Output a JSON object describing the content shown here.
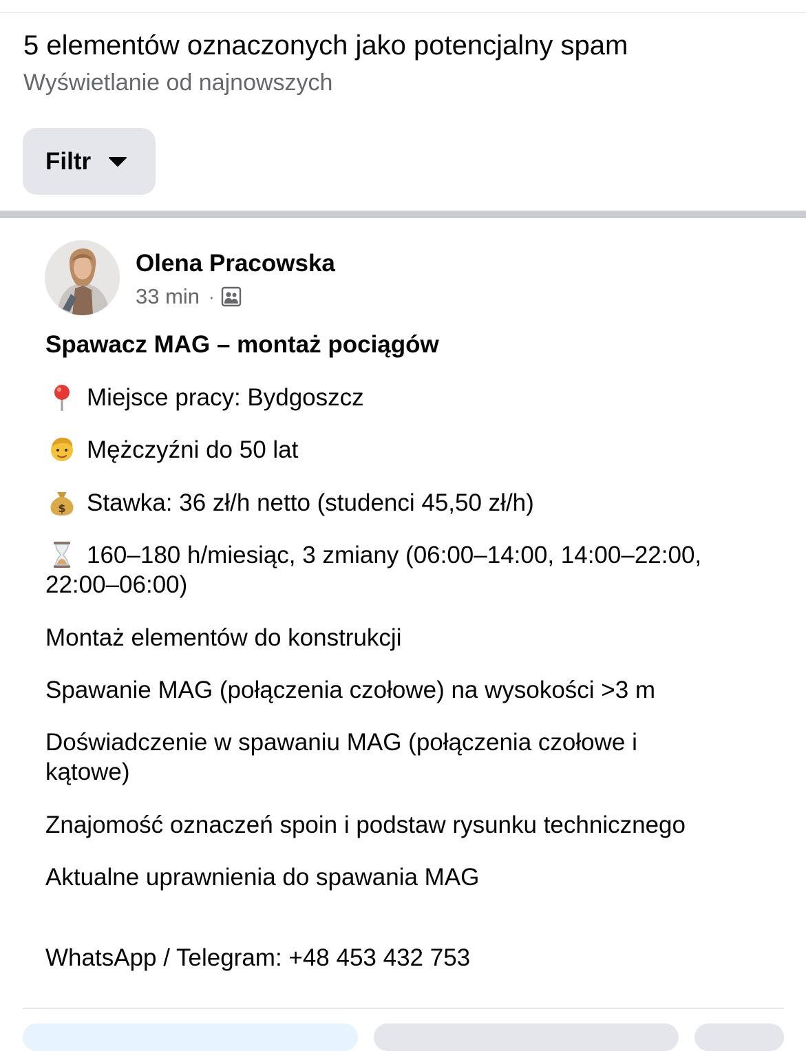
{
  "header": {
    "title": "5 elementów oznaczonych jako potencjalny spam",
    "subtitle": "Wyświetlanie od najnowszych",
    "filter_label": "Filtr"
  },
  "post": {
    "author": "Olena Pracowska",
    "time": "33 min",
    "meta_separator": "·",
    "audience_icon": "group-icon",
    "title": "Spawacz MAG – montaż pociągów",
    "lines": [
      {
        "emoji": "pushpin",
        "text": "Miejsce pracy: Bydgoszcz"
      },
      {
        "emoji": "man",
        "text": "Mężczyźni do 50 lat"
      },
      {
        "emoji": "money-bag",
        "text": "Stawka: 36 zł/h netto (studenci 45,50 zł/h)"
      },
      {
        "emoji": "hourglass",
        "text": "160–180 h/miesiąc, 3 zmiany (06:00–14:00, 14:00–22:00, 22:00–06:00)"
      },
      {
        "text": "Montaż elementów do konstrukcji"
      },
      {
        "text": "Spawanie MAG (połączenia czołowe) na wysokości >3 m"
      },
      {
        "text": "Doświadczenie w spawaniu MAG (połączenia czołowe i kątowe)"
      },
      {
        "text": "Znajomość oznaczeń spoin i podstaw rysunku technicznego"
      },
      {
        "text": "Aktualne uprawnienia do spawania MAG"
      },
      {
        "text": "WhatsApp / Telegram: +48 453 432 753"
      }
    ]
  },
  "colors": {
    "text_primary": "#050505",
    "text_secondary": "#65676b",
    "button_bg": "#e4e6eb",
    "primary_button_bg": "#e7f3ff",
    "separator": "#c9ccd1"
  }
}
